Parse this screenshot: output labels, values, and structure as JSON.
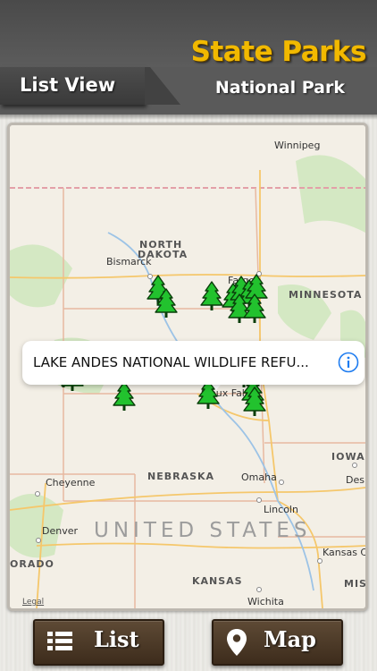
{
  "header": {
    "title": "State Parks",
    "subtitle": "National Park",
    "list_view_tab": "List View"
  },
  "map": {
    "states": [
      "NORTH",
      "DAKOTA",
      "MINNESOTA",
      "NEBRASKA",
      "IOWA",
      "KANSAS",
      "ORADO",
      "MISS"
    ],
    "cities": [
      "Winnipeg",
      "Bismarck",
      "Fargo",
      "Sioux Falls",
      "Omaha",
      "Lincoln",
      "Cheyenne",
      "Denver",
      "Kansas C",
      "Des",
      "Wichita"
    ],
    "country_label": "UNITED STATES",
    "legal_label": "Legal"
  },
  "callout": {
    "title": "LAKE ANDES NATIONAL WILDLIFE REFU...",
    "info_icon": "info-circle-icon"
  },
  "bottom_bar": {
    "list_label": "List",
    "list_icon": "list-icon",
    "map_label": "Map",
    "map_icon": "map-pin-icon"
  },
  "colors": {
    "title": "#f2b900",
    "marker": "#22c22e",
    "header": "#4f4f4f",
    "button": "#4d3a28"
  }
}
